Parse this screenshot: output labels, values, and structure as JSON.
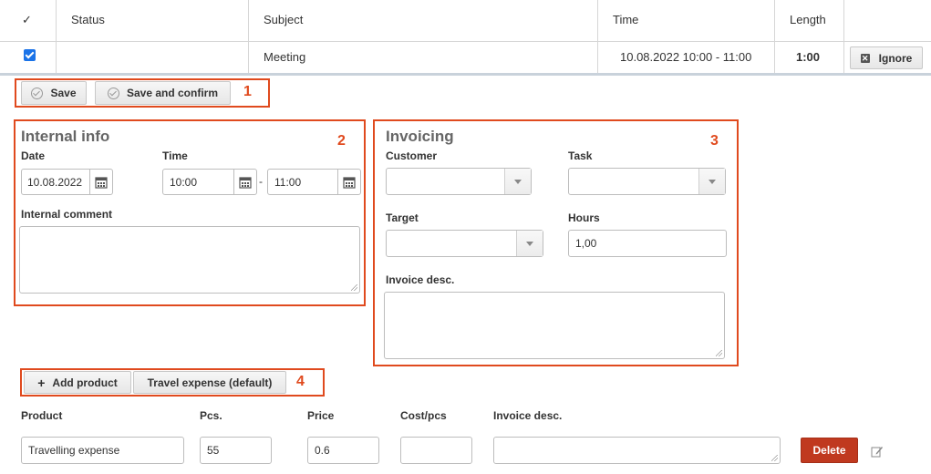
{
  "table": {
    "headers": {
      "check": "✓",
      "status": "Status",
      "subject": "Subject",
      "time": "Time",
      "length": "Length"
    },
    "row": {
      "checked": true,
      "status": "",
      "subject": "Meeting",
      "time": "10.08.2022 10:00 - 11:00",
      "length": "1:00",
      "ignore_label": "Ignore"
    }
  },
  "actions": {
    "save_label": "Save",
    "save_confirm_label": "Save and confirm",
    "marker": "1"
  },
  "internal": {
    "title": "Internal info",
    "marker": "2",
    "date_label": "Date",
    "date_value": "10.08.2022",
    "time_label": "Time",
    "time_from": "10:00",
    "time_sep": "-",
    "time_to": "11:00",
    "comment_label": "Internal comment",
    "comment_value": ""
  },
  "invoicing": {
    "title": "Invoicing",
    "marker": "3",
    "customer_label": "Customer",
    "customer_value": "",
    "task_label": "Task",
    "task_value": "",
    "target_label": "Target",
    "target_value": "",
    "hours_label": "Hours",
    "hours_value": "1,00",
    "desc_label": "Invoice desc.",
    "desc_value": ""
  },
  "products": {
    "add_label": "Add product",
    "travel_label": "Travel expense (default)",
    "marker": "4",
    "headers": {
      "product": "Product",
      "pcs": "Pcs.",
      "price": "Price",
      "cost": "Cost/pcs",
      "desc": "Invoice desc."
    },
    "row": {
      "product": "Travelling expense",
      "pcs": "55",
      "price": "0.6",
      "cost": "",
      "desc": ""
    },
    "delete_label": "Delete"
  },
  "colors": {
    "accent_red": "#e04a1e",
    "delete_red": "#c0391f",
    "checkbox_blue": "#1a73e8"
  }
}
